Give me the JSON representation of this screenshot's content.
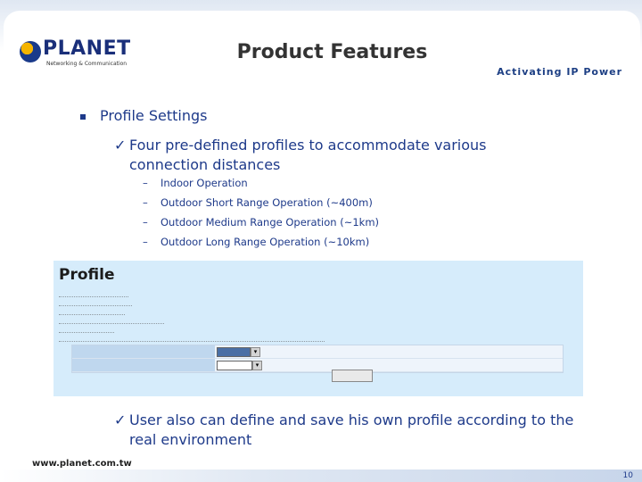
{
  "header": {
    "logo_text": "PLANET",
    "logo_sub": "Networking & Communication",
    "title": "Product Features",
    "tagline": "Activating IP Power"
  },
  "content": {
    "bullet_marker": "§",
    "bullet1": "Profile Settings",
    "check_mark": "ü",
    "check1": "Four pre-defined profiles to accommodate various connection distances",
    "dash_marker": "–",
    "dash_items": [
      "Indoor Operation",
      "Outdoor Short Range Operation (~400m)",
      "Outdoor Medium Range Operation (~1km)",
      "Outdoor Long Range Operation (~10km)"
    ],
    "check2": "User also can define and save his own profile according to the real environment"
  },
  "screenshot": {
    "title": "Profile"
  },
  "footer": {
    "url": "www.planet.com.tw",
    "page": "10"
  },
  "colors": {
    "accent": "#1e3a8a",
    "screenshot_bg": "#d6ecfb"
  }
}
